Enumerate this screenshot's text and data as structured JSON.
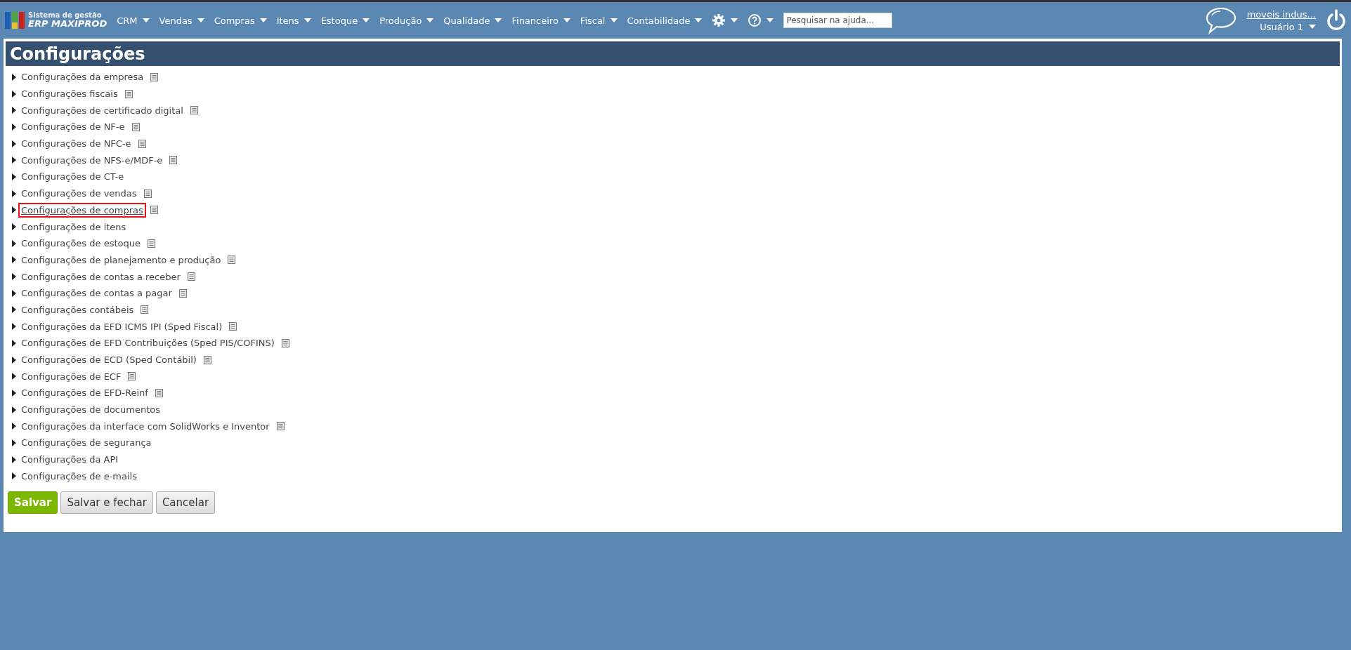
{
  "brand": {
    "subtitle": "Sistema de gestão",
    "name": "ERP MAXIPROD"
  },
  "menu": [
    {
      "label": "CRM"
    },
    {
      "label": "Vendas"
    },
    {
      "label": "Compras"
    },
    {
      "label": "Itens"
    },
    {
      "label": "Estoque"
    },
    {
      "label": "Produção"
    },
    {
      "label": "Qualidade"
    },
    {
      "label": "Financeiro"
    },
    {
      "label": "Fiscal"
    },
    {
      "label": "Contabilidade"
    }
  ],
  "search": {
    "placeholder": "Pesquisar na ajuda..."
  },
  "account": {
    "company": "moveis indus...",
    "user": "Usuário 1"
  },
  "page": {
    "title": "Configurações"
  },
  "sections": [
    {
      "label": "Configurações da empresa",
      "help": true,
      "highlighted": false
    },
    {
      "label": "Configurações fiscais",
      "help": true,
      "highlighted": false
    },
    {
      "label": "Configurações de certificado digital",
      "help": true,
      "highlighted": false
    },
    {
      "label": "Configurações de NF-e",
      "help": true,
      "highlighted": false
    },
    {
      "label": "Configurações de NFC-e",
      "help": true,
      "highlighted": false
    },
    {
      "label": "Configurações de NFS-e/MDF-e",
      "help": true,
      "highlighted": false
    },
    {
      "label": "Configurações de CT-e",
      "help": false,
      "highlighted": false
    },
    {
      "label": "Configurações de vendas",
      "help": true,
      "highlighted": false
    },
    {
      "label": "Configurações de compras",
      "help": true,
      "highlighted": true
    },
    {
      "label": "Configurações de itens",
      "help": false,
      "highlighted": false
    },
    {
      "label": "Configurações de estoque",
      "help": true,
      "highlighted": false
    },
    {
      "label": "Configurações de planejamento e produção",
      "help": true,
      "highlighted": false
    },
    {
      "label": "Configurações de contas a receber",
      "help": true,
      "highlighted": false
    },
    {
      "label": "Configurações de contas a pagar",
      "help": true,
      "highlighted": false
    },
    {
      "label": "Configurações contábeis",
      "help": true,
      "highlighted": false
    },
    {
      "label": "Configurações da EFD ICMS IPI (Sped Fiscal)",
      "help": true,
      "highlighted": false
    },
    {
      "label": "Configurações de EFD Contribuições (Sped PIS/COFINS)",
      "help": true,
      "highlighted": false
    },
    {
      "label": "Configurações de ECD (Sped Contábil)",
      "help": true,
      "highlighted": false
    },
    {
      "label": "Configurações de ECF",
      "help": true,
      "highlighted": false
    },
    {
      "label": "Configurações de EFD-Reinf",
      "help": true,
      "highlighted": false
    },
    {
      "label": "Configurações de documentos",
      "help": false,
      "highlighted": false
    },
    {
      "label": "Configurações da interface com SolidWorks e Inventor",
      "help": true,
      "highlighted": false
    },
    {
      "label": "Configurações de segurança",
      "help": false,
      "highlighted": false
    },
    {
      "label": "Configurações da API",
      "help": false,
      "highlighted": false
    },
    {
      "label": "Configurações de e-mails",
      "help": false,
      "highlighted": false
    }
  ],
  "buttons": [
    {
      "label": "Salvar",
      "kind": "primary"
    },
    {
      "label": "Salvar e fechar",
      "kind": "secondary"
    },
    {
      "label": "Cancelar",
      "kind": "secondary"
    }
  ]
}
